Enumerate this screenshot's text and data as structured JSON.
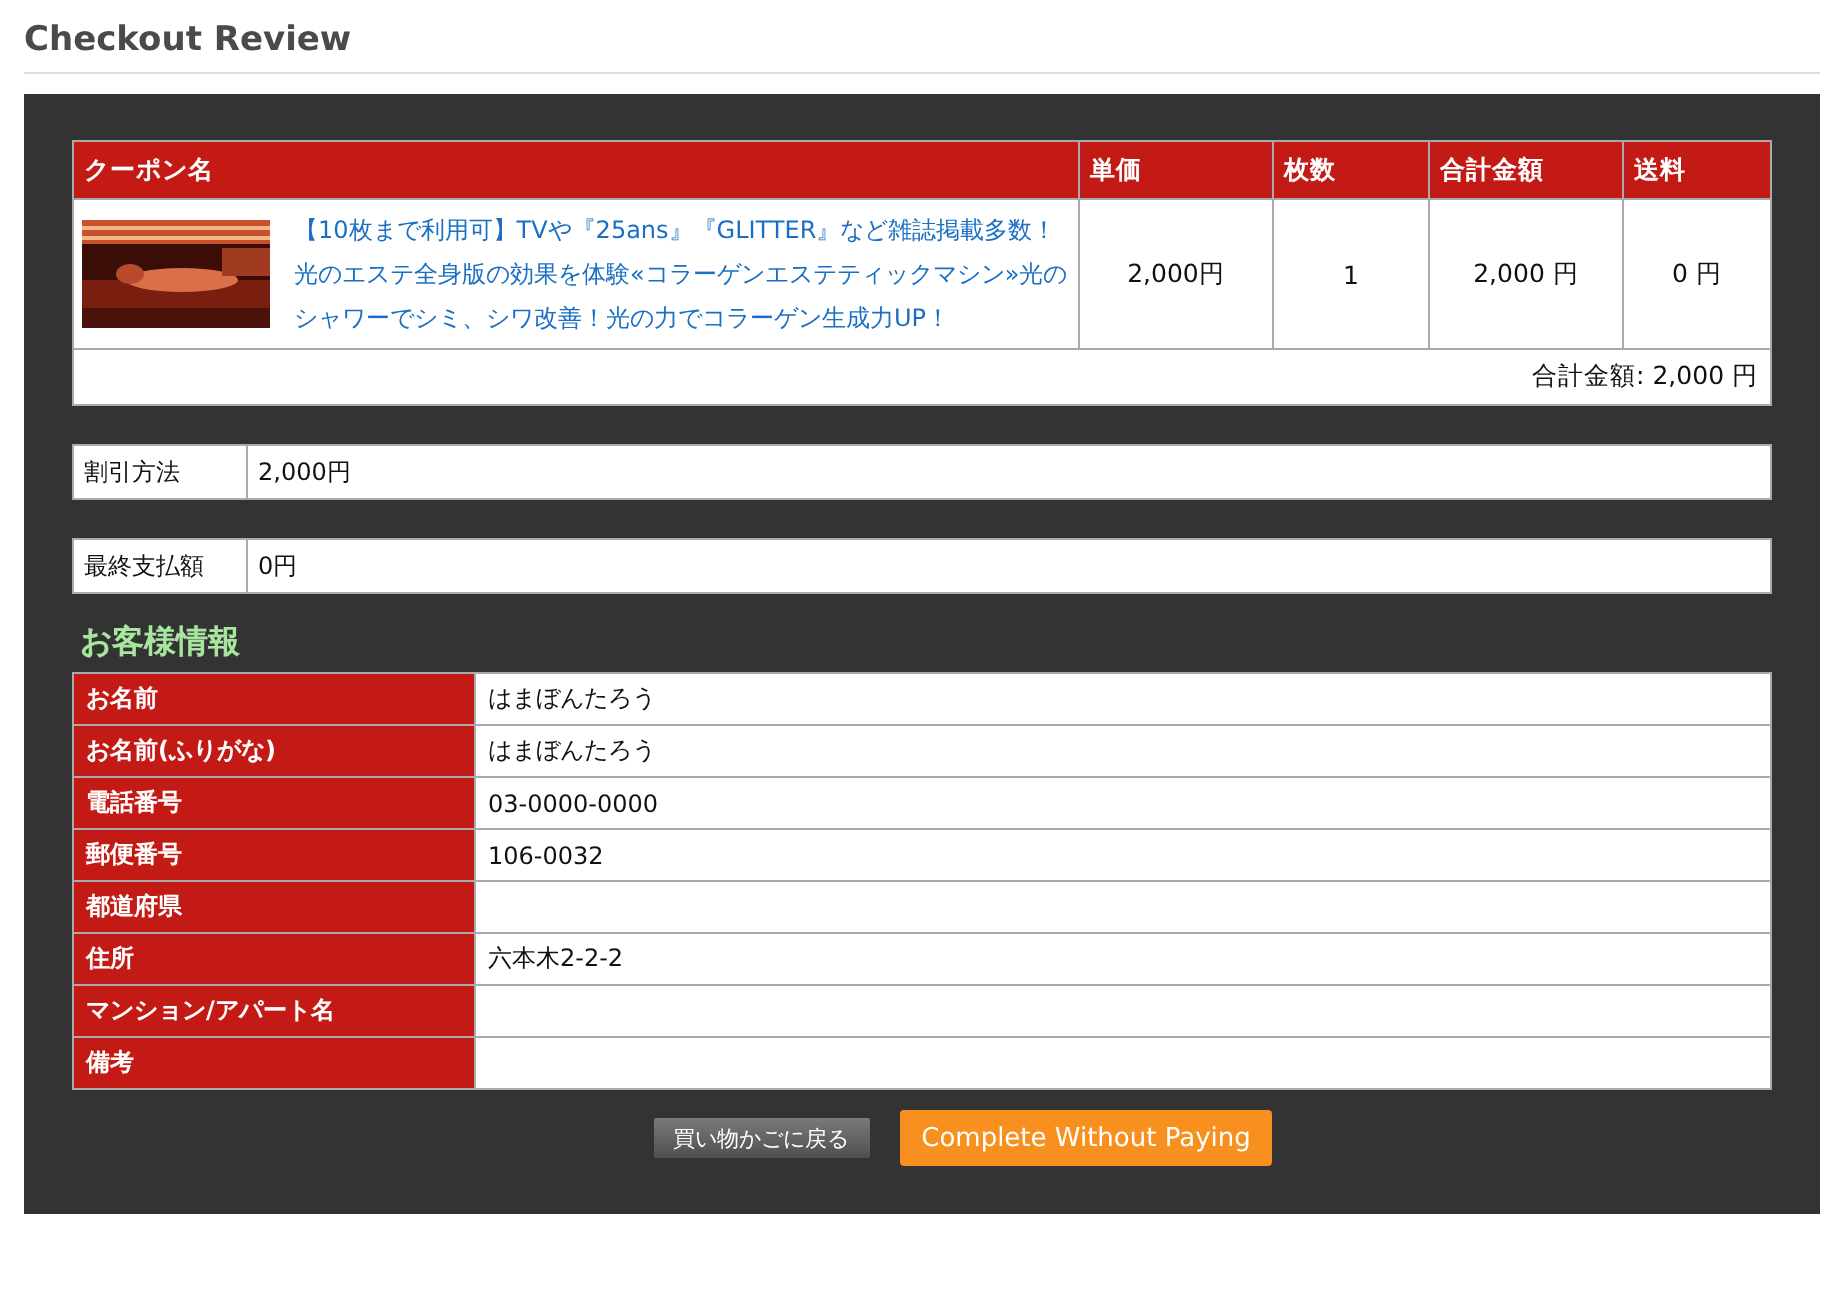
{
  "page": {
    "title": "Checkout Review"
  },
  "cart": {
    "columns": [
      "クーポン名",
      "単価",
      "枚数",
      "合計金額",
      "送料"
    ],
    "rows": [
      {
        "name": "【10枚まで利用可】TVや『25ans』『GLITTER』など雑誌掲載多数！光のエステ全身版の効果を体験«コラーゲンエステティックマシン»光のシャワーでシミ、シワ改善！光の力でコラーゲン生成力UP！",
        "unit_price": "2,000円",
        "quantity": "1",
        "total": "2,000 円",
        "shipping": "0 円"
      }
    ],
    "grand_total": "合計金額: 2,000 円"
  },
  "discount": {
    "label": "割引方法",
    "value": "2,000円"
  },
  "final_payment": {
    "label": "最終支払額",
    "value": "0円"
  },
  "customer": {
    "heading": "お客様情報",
    "fields": [
      {
        "label": "お名前",
        "value": "はまぼんたろう"
      },
      {
        "label": "お名前(ふりがな)",
        "value": "はまぼんたろう"
      },
      {
        "label": "電話番号",
        "value": "03-0000-0000"
      },
      {
        "label": "郵便番号",
        "value": "106-0032"
      },
      {
        "label": "都道府県"
      },
      {
        "label": "住所",
        "value": "六本木2-2-2"
      },
      {
        "label": "マンション/アパート名"
      },
      {
        "label": "備考"
      }
    ]
  },
  "buttons": [
    {
      "label": "買い物かごに戻る",
      "kind": "secondary"
    },
    {
      "label": "Complete Without Paying",
      "kind": "primary"
    }
  ]
}
